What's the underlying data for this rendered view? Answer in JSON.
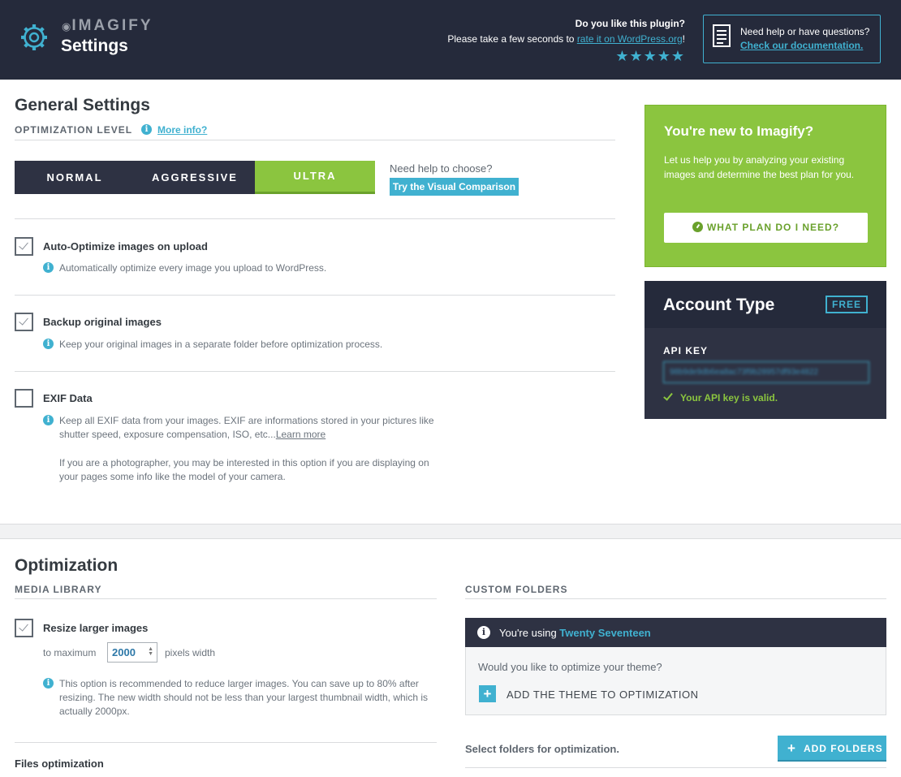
{
  "header": {
    "brand": "IMAGIFY",
    "title": "Settings",
    "rate_question": "Do you like this plugin?",
    "rate_prefix": "Please take a few seconds to ",
    "rate_link": "rate it on WordPress.org",
    "rate_suffix": "!",
    "stars": "★★★★★",
    "help_question": "Need help or have questions?",
    "help_link": "Check our documentation."
  },
  "general": {
    "title": "General Settings",
    "optimization_level_label": "OPTIMIZATION LEVEL",
    "more_info": "More info?",
    "levels": [
      {
        "label": "NORMAL"
      },
      {
        "label": "AGGRESSIVE"
      },
      {
        "label": "ULTRA"
      }
    ],
    "selected_level": "ULTRA",
    "choose_help": "Need help to choose?",
    "visual_comparison": "Try the Visual Comparison",
    "options": [
      {
        "title": "Auto-Optimize images on upload",
        "checked": true,
        "desc": "Automatically optimize every image you upload to WordPress."
      },
      {
        "title": "Backup original images",
        "checked": true,
        "desc": "Keep your original images in a separate folder before optimization process."
      },
      {
        "title": "EXIF Data",
        "checked": false,
        "desc_line1": "Keep all EXIF data from your images. EXIF are informations stored in your pictures like",
        "desc_line2": "shutter speed, exposure compensation, ISO, etc...",
        "learn_more": "Learn more",
        "extra_line1": "If you are a photographer, you may be interested in this option if you are displaying on",
        "extra_line2": "your pages some info like the model of your camera."
      }
    ]
  },
  "sidebar": {
    "new_title": "You're new to Imagify?",
    "new_text": "Let us help you by analyzing your existing images and determine the best plan for you.",
    "plan_button": "WHAT PLAN DO I NEED?",
    "account_title": "Account Type",
    "account_badge": "FREE",
    "api_key_label": "API KEY",
    "api_key_value": "98b9de9db6ea8ac73f9b28957df93e4822",
    "api_valid": "Your API key is valid."
  },
  "optimization": {
    "title": "Optimization",
    "media_library_label": "MEDIA LIBRARY",
    "resize_title": "Resize larger images",
    "resize_checked": true,
    "to_maximum": "to maximum",
    "max_width": "2000",
    "pixels_width": "pixels width",
    "resize_desc_line1": "This option is recommended to reduce larger images. You can save up to 80% after",
    "resize_desc_line2": "resizing. The new width should not be less than your largest thumbnail width, which is",
    "resize_desc_line3": "actually 2000px.",
    "files_optimization": "Files optimization",
    "custom_folders_label": "CUSTOM FOLDERS",
    "theme_using_prefix": "You're using ",
    "theme_name": "Twenty Seventeen",
    "theme_question": "Would you like to optimize your theme?",
    "add_theme": "ADD THE THEME TO OPTIMIZATION",
    "select_folders": "Select folders for optimization.",
    "add_folders": "ADD FOLDERS"
  },
  "colors": {
    "header_bg": "#252a3b",
    "accent_blue": "#40b1d0",
    "accent_green": "#8bc53f"
  },
  "icons": {
    "logo": "gear-icon",
    "help": "document-icon",
    "info": "info-icon",
    "check": "check-icon",
    "plus": "plus-icon",
    "gauge": "gauge-icon"
  }
}
